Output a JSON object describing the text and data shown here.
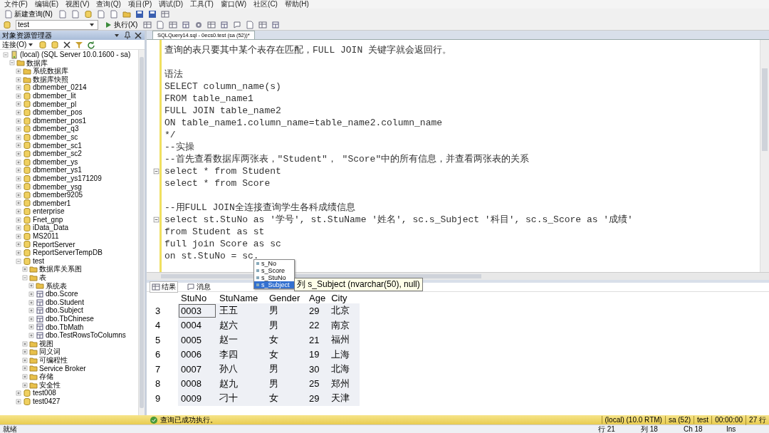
{
  "menu": [
    "文件(F)",
    "编辑(E)",
    "视图(V)",
    "查询(Q)",
    "项目(P)",
    "调试(D)",
    "工具(T)",
    "窗口(W)",
    "社区(C)",
    "帮助(H)"
  ],
  "toolbar": {
    "new_query": "新建查询(N)",
    "database": "test",
    "execute": "执行(X)"
  },
  "explorer": {
    "title": "对象资源管理器",
    "connect": "连接(O)",
    "tree": [
      {
        "label": "(local) (SQL Server 10.0.1600 - sa)",
        "kind": "server",
        "expanded": true,
        "children": [
          {
            "label": "数据库",
            "kind": "folder",
            "expanded": true,
            "children": [
              {
                "label": "系统数据库",
                "kind": "folder",
                "expanded": false
              },
              {
                "label": "数据库快照",
                "kind": "folder",
                "expanded": false
              },
              {
                "label": "dbmember_0214",
                "kind": "database",
                "expanded": false
              },
              {
                "label": "dbmember_lit",
                "kind": "database",
                "expanded": false
              },
              {
                "label": "dbmember_pl",
                "kind": "database",
                "expanded": false
              },
              {
                "label": "dbmember_pos",
                "kind": "database",
                "expanded": false
              },
              {
                "label": "dbmember_pos1",
                "kind": "database",
                "expanded": false
              },
              {
                "label": "dbmember_q3",
                "kind": "database",
                "expanded": false
              },
              {
                "label": "dbmember_sc",
                "kind": "database",
                "expanded": false
              },
              {
                "label": "dbmember_sc1",
                "kind": "database",
                "expanded": false
              },
              {
                "label": "dbmember_sc2",
                "kind": "database",
                "expanded": false
              },
              {
                "label": "dbmember_ys",
                "kind": "database",
                "expanded": false
              },
              {
                "label": "dbmember_ys1",
                "kind": "database",
                "expanded": false
              },
              {
                "label": "dbmember_ys171209",
                "kind": "database",
                "expanded": false
              },
              {
                "label": "dbmember_ysg",
                "kind": "database",
                "expanded": false
              },
              {
                "label": "dbmember9205",
                "kind": "database",
                "expanded": false
              },
              {
                "label": "dbmember1",
                "kind": "database",
                "expanded": false
              },
              {
                "label": "enterprise",
                "kind": "database",
                "expanded": false
              },
              {
                "label": "Fnet_gnp",
                "kind": "database",
                "expanded": false
              },
              {
                "label": "iData_Data",
                "kind": "database",
                "expanded": false
              },
              {
                "label": "MS2011",
                "kind": "database",
                "expanded": false
              },
              {
                "label": "ReportServer",
                "kind": "database",
                "expanded": false
              },
              {
                "label": "ReportServerTempDB",
                "kind": "database",
                "expanded": false
              },
              {
                "label": "test",
                "kind": "database",
                "expanded": true,
                "children": [
                  {
                    "label": "数据库关系图",
                    "kind": "folder",
                    "expanded": false
                  },
                  {
                    "label": "表",
                    "kind": "folder",
                    "expanded": true,
                    "children": [
                      {
                        "label": "系统表",
                        "kind": "folder",
                        "expanded": false
                      },
                      {
                        "label": "dbo.Score",
                        "kind": "table",
                        "expanded": false
                      },
                      {
                        "label": "dbo.Student",
                        "kind": "table",
                        "expanded": false
                      },
                      {
                        "label": "dbo.Subject",
                        "kind": "table",
                        "expanded": false
                      },
                      {
                        "label": "dbo.TbChinese",
                        "kind": "table",
                        "expanded": false
                      },
                      {
                        "label": "dbo.TbMath",
                        "kind": "table",
                        "expanded": false
                      },
                      {
                        "label": "dbo.TestRowsToColumns",
                        "kind": "table",
                        "expanded": false
                      }
                    ]
                  },
                  {
                    "label": "视图",
                    "kind": "folder",
                    "expanded": false
                  },
                  {
                    "label": "同义词",
                    "kind": "folder",
                    "expanded": false
                  },
                  {
                    "label": "可编程性",
                    "kind": "folder",
                    "expanded": false
                  },
                  {
                    "label": "Service Broker",
                    "kind": "folder",
                    "expanded": false
                  },
                  {
                    "label": "存储",
                    "kind": "folder",
                    "expanded": false
                  },
                  {
                    "label": "安全性",
                    "kind": "folder",
                    "expanded": false
                  }
                ]
              },
              {
                "label": "test008",
                "kind": "database",
                "expanded": false
              },
              {
                "label": "test0427",
                "kind": "database",
                "expanded": false
              }
            ]
          }
        ]
      }
    ]
  },
  "editor": {
    "tab": "SQLQuery14.sql - 0ecs0.test (sa (52))*",
    "lines": [
      {
        "text": "查询的表只要其中某个表存在匹配，FULL JOIN 关键字就会返回行。",
        "collapsible": false
      },
      {
        "collapsible": false
      },
      {
        "text": "语法",
        "collapsible": false
      },
      {
        "text": "SELECT column_name(s)",
        "collapsible": false
      },
      {
        "text": "FROM table_name1",
        "collapsible": false
      },
      {
        "text": "FULL JOIN table_name2",
        "collapsible": false
      },
      {
        "text": "ON table_name1.column_name=table_name2.column_name",
        "collapsible": false
      },
      {
        "text": "*/",
        "collapsible": false
      },
      {
        "text": "--实操",
        "collapsible": false
      },
      {
        "text": "--首先查看数据库两张表，\"Student\"， \"Score\"中的所有信息，并查看两张表的关系",
        "collapsible": false
      },
      {
        "text": "select * from Student",
        "collapsible": true
      },
      {
        "text": "select * from Score",
        "collapsible": false
      },
      {
        "collapsible": false
      },
      {
        "text": "--用FULL JOIN全连接查询学生各科成绩信息",
        "collapsible": false
      },
      {
        "text": "select st.StuNo as '学号', st.StuName '姓名', sc.s_Subject '科目', sc.s_Score as '成绩'",
        "collapsible": true
      },
      {
        "text": "from Student as st",
        "collapsible": false
      },
      {
        "text": "full join Score as sc",
        "collapsible": false
      },
      {
        "text": "on st.StuNo = sc.",
        "collapsible": false
      }
    ],
    "completion": [
      {
        "label": "s_No",
        "selected": false
      },
      {
        "label": "s_Score",
        "selected": false
      },
      {
        "label": "s_StuNo",
        "selected": false
      },
      {
        "label": "s_Subject",
        "selected": true
      }
    ],
    "tooltip": "列 s_Subject (nvarchar(50), null)"
  },
  "results": {
    "tabs": [
      {
        "label": "结果",
        "selected": true
      },
      {
        "label": "消息",
        "selected": false
      }
    ],
    "columns": [
      "StuNo",
      "StuName",
      "Gender",
      "Age",
      "City"
    ],
    "rows": [
      {
        "num": "3",
        "cells": [
          "0003",
          "王五",
          "男",
          "29",
          "北京"
        ]
      },
      {
        "num": "4",
        "cells": [
          "0004",
          "赵六",
          "男",
          "22",
          "南京"
        ]
      },
      {
        "num": "5",
        "cells": [
          "0005",
          "赵一",
          "女",
          "21",
          "福州"
        ]
      },
      {
        "num": "6",
        "cells": [
          "0006",
          "李四",
          "女",
          "19",
          "上海"
        ]
      },
      {
        "num": "7",
        "cells": [
          "0007",
          "孙八",
          "男",
          "30",
          "北海"
        ]
      },
      {
        "num": "8",
        "cells": [
          "0008",
          "赵九",
          "男",
          "25",
          "郑州"
        ]
      },
      {
        "num": "9",
        "cells": [
          "0009",
          "刁十",
          "女",
          "29",
          "天津"
        ]
      }
    ]
  },
  "status": {
    "message": "查询已成功执行。",
    "fields": [
      "(local) (10.0 RTM)",
      "sa (52)",
      "test",
      "00:00:00",
      "27 行"
    ]
  },
  "bottom_bar": {
    "ready": "就绪",
    "fields": [
      "行 21",
      "列 18",
      "Ch 18",
      "Ins"
    ]
  }
}
